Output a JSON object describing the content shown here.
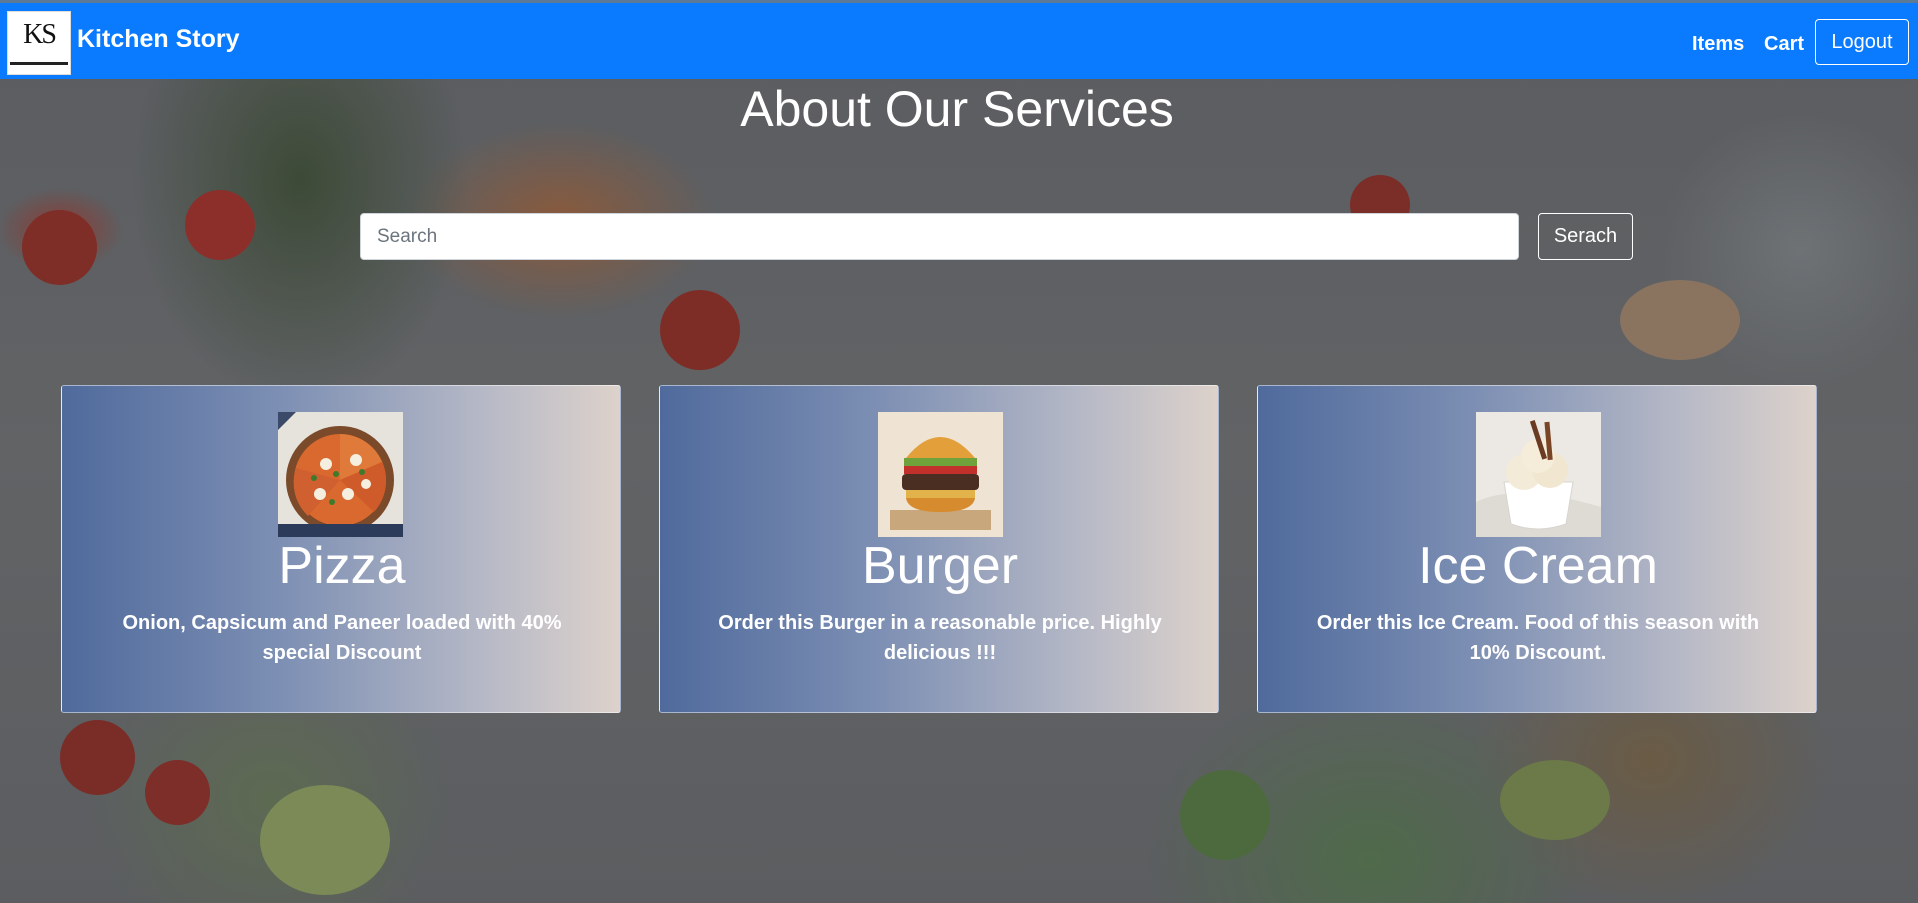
{
  "brand": {
    "logo_text": "KS",
    "name": "Kitchen Story"
  },
  "nav": {
    "items_label": "Items",
    "cart_label": "Cart",
    "logout_label": "Logout"
  },
  "page": {
    "heading": "About Our Services"
  },
  "search": {
    "placeholder": "Search",
    "value": "",
    "button_label": "Serach"
  },
  "cards": [
    {
      "title": "Pizza",
      "description": "Onion, Capsicum and Paneer loaded with 40% special Discount",
      "image": "pizza-image"
    },
    {
      "title": "Burger",
      "description": "Order this Burger in a reasonable price. Highly delicious !!!",
      "image": "burger-image"
    },
    {
      "title": "Ice Cream",
      "description": "Order this Ice Cream. Food of this season with 10% Discount.",
      "image": "ice-cream-image"
    }
  ],
  "colors": {
    "navbar": "#0a7bff",
    "text": "#ffffff"
  }
}
